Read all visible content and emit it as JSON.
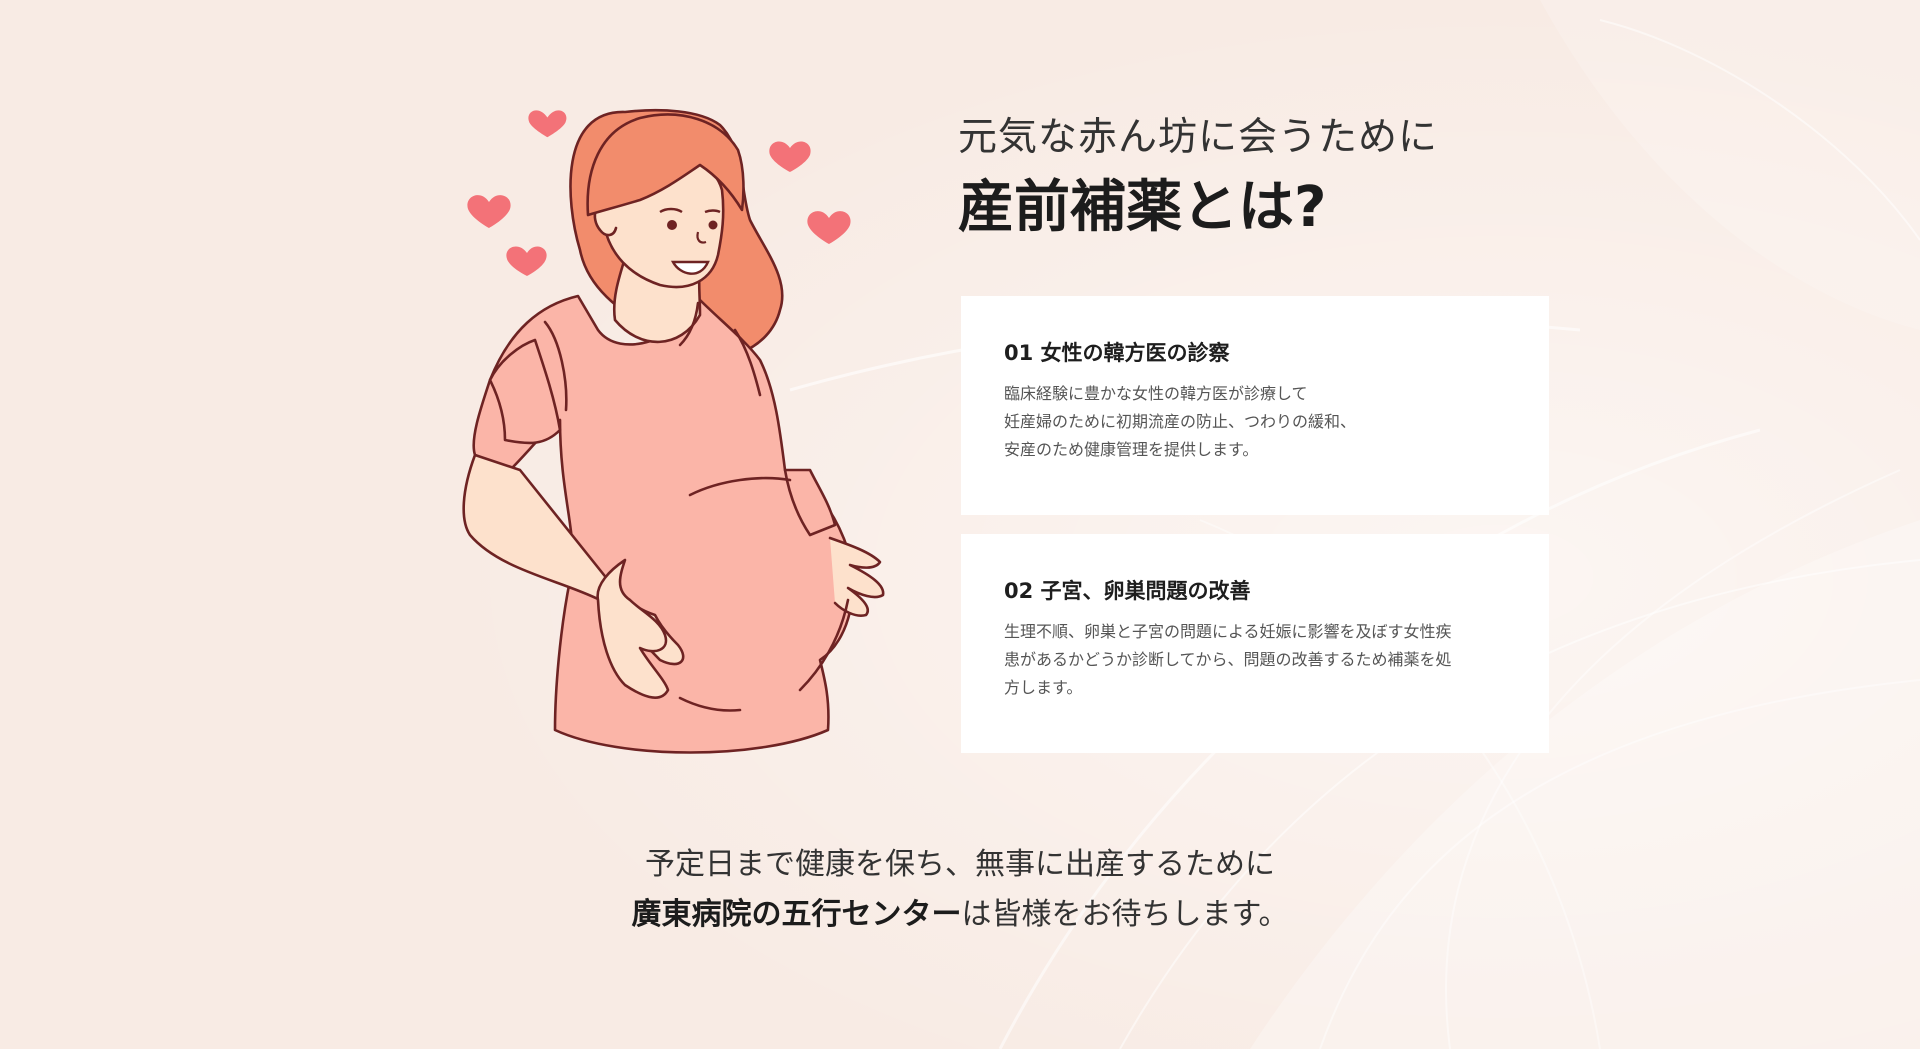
{
  "colors": {
    "background": "#f8ebe4",
    "hair": "#f28c6c",
    "dress": "#fbb5a8",
    "skin": "#fde1cc",
    "heart": "#f37278",
    "outline": "#6e2323",
    "card": "#ffffff"
  },
  "icons": [
    "heart-icon",
    "pregnant-woman-illustration"
  ],
  "heading": {
    "subtitle": "元気な赤ん坊に会うために",
    "title": "産前補薬とは?"
  },
  "cards": [
    {
      "title": "01 女性の韓方医の診察",
      "body": "臨床経験に豊かな女性の韓方医が診療して\n妊産婦のために初期流産の防止、つわりの緩和、\n安産のため健康管理を提供します。"
    },
    {
      "title": "02 子宮、卵巣問題の改善",
      "body": "生理不順、卵巣と子宮の問題による妊娠に影響を及ぼす女性疾\n患があるかどうか診断してから、問題の改善するため補薬を処\n方します。"
    }
  ],
  "closing": {
    "line1": "予定日まで健康を保ち、無事に出産するために",
    "line2_strong": "廣東病院の五行センター",
    "line2_rest": "は皆様をお待ちします。"
  }
}
